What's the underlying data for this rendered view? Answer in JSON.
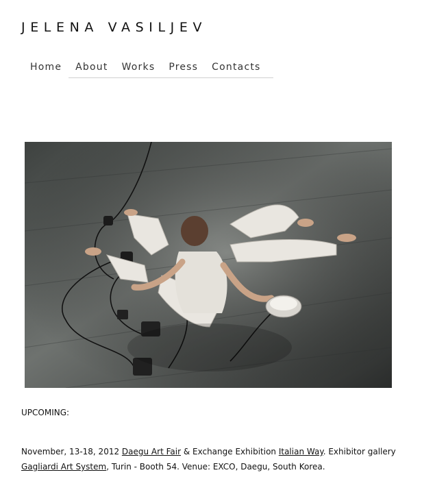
{
  "site": {
    "title": "JELENA VASILJEV"
  },
  "nav": {
    "items": [
      {
        "label": "Home"
      },
      {
        "label": "About"
      },
      {
        "label": "Works"
      },
      {
        "label": "Press"
      },
      {
        "label": "Contacts"
      }
    ]
  },
  "hero": {
    "alt": "Performance photograph"
  },
  "news": {
    "label": "UPCOMING:",
    "date": "November, 13-18, 2012 ",
    "link1": "Daegu Art Fair",
    "text1": " & Exchange Exhibition ",
    "link2": "Italian Way",
    "text2": ". Exhibitor gallery ",
    "link3": "Gagliardi Art System",
    "text3": ", Turin - Booth 54. Venue: EXCO, Daegu, South  Korea."
  }
}
